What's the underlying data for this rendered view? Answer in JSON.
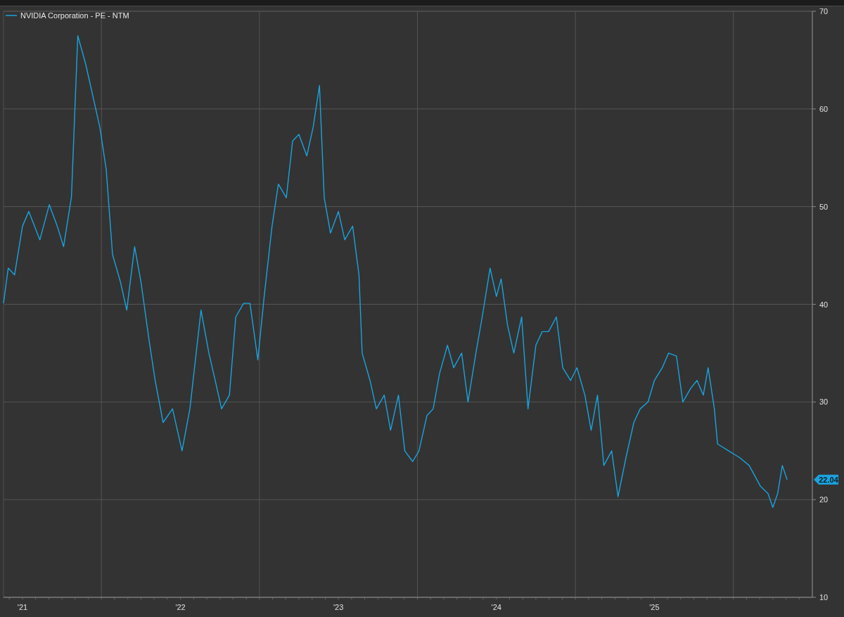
{
  "chart": {
    "chart_data": {
      "type": "line",
      "xlim": [
        2020.88,
        2026.0
      ],
      "ylim": [
        10,
        70
      ],
      "yticks": [
        10,
        20,
        30,
        40,
        50,
        60,
        70
      ],
      "xticks": [
        {
          "value": 2021,
          "label": "'21"
        },
        {
          "value": 2022,
          "label": "'22"
        },
        {
          "value": 2023,
          "label": "'23"
        },
        {
          "value": 2024,
          "label": "'24"
        },
        {
          "value": 2025,
          "label": "'25"
        }
      ],
      "x": [
        2020.88,
        2020.91,
        2020.95,
        2021.0,
        2021.04,
        2021.11,
        2021.17,
        2021.22,
        2021.26,
        2021.31,
        2021.35,
        2021.4,
        2021.44,
        2021.49,
        2021.53,
        2021.57,
        2021.62,
        2021.66,
        2021.71,
        2021.75,
        2021.8,
        2021.84,
        2021.89,
        2021.95,
        2022.01,
        2022.06,
        2022.13,
        2022.18,
        2022.22,
        2022.26,
        2022.31,
        2022.35,
        2022.4,
        2022.44,
        2022.49,
        2022.53,
        2022.58,
        2022.62,
        2022.67,
        2022.71,
        2022.75,
        2022.8,
        2022.84,
        2022.88,
        2022.91,
        2022.95,
        2023.0,
        2023.04,
        2023.09,
        2023.13,
        2023.15,
        2023.2,
        2023.24,
        2023.29,
        2023.33,
        2023.38,
        2023.42,
        2023.47,
        2023.51,
        2023.56,
        2023.6,
        2023.64,
        2023.69,
        2023.73,
        2023.78,
        2023.82,
        2023.87,
        2023.91,
        2023.96,
        2024.0,
        2024.03,
        2024.07,
        2024.11,
        2024.16,
        2024.2,
        2024.25,
        2024.29,
        2024.33,
        2024.38,
        2024.42,
        2024.47,
        2024.51,
        2024.56,
        2024.6,
        2024.64,
        2024.68,
        2024.73,
        2024.77,
        2024.82,
        2024.87,
        2024.91,
        2024.96,
        2025.0,
        2025.05,
        2025.09,
        2025.14,
        2025.18,
        2025.23,
        2025.27,
        2025.31,
        2025.34,
        2025.38,
        2025.4,
        2025.47,
        2025.54,
        2025.6,
        2025.67,
        2025.72,
        2025.75,
        2025.78,
        2025.81,
        2025.84
      ],
      "series": [
        {
          "name": "NVIDIA Corporation - PE - NTM",
          "color": "#1aa3dd",
          "values": [
            40.1,
            43.7,
            43,
            48,
            49.5,
            46.6,
            50.2,
            48,
            45.9,
            51,
            67.5,
            64.6,
            61.7,
            58.1,
            53.8,
            45.1,
            42.3,
            39.4,
            45.9,
            42.3,
            36.5,
            32.2,
            27.9,
            29.3,
            25,
            29.3,
            39.4,
            35,
            32.2,
            29.3,
            30.7,
            38.7,
            40.1,
            40.1,
            34.3,
            40.8,
            48,
            52.3,
            50.9,
            56.7,
            57.4,
            55.2,
            58.1,
            62.4,
            50.9,
            47.3,
            49.5,
            46.6,
            48,
            43,
            35,
            32.2,
            29.3,
            30.7,
            27.1,
            30.7,
            25,
            23.9,
            25,
            28.6,
            29.3,
            32.9,
            35.8,
            33.5,
            35,
            30,
            35,
            38.7,
            43.7,
            40.8,
            42.6,
            37.9,
            35,
            38.7,
            29.3,
            35.8,
            37.2,
            37.2,
            38.7,
            33.5,
            32.2,
            33.5,
            30.7,
            27.1,
            30.7,
            23.5,
            25,
            20.3,
            24.3,
            27.9,
            29.3,
            30,
            32.2,
            33.5,
            35,
            34.7,
            30,
            31.4,
            32.2,
            30.7,
            33.5,
            29.3,
            25.7,
            25,
            24.3,
            23.5,
            21.4,
            20.6,
            19.2,
            20.6,
            23.5,
            22.04
          ]
        }
      ],
      "grid": true,
      "annotations": [
        {
          "text": "22.04"
        }
      ]
    }
  }
}
